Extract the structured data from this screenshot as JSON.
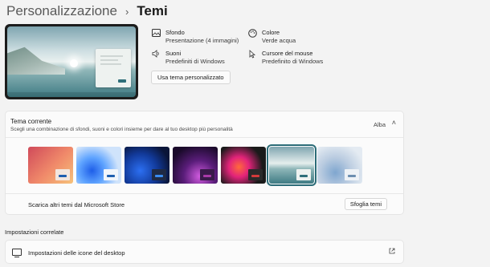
{
  "breadcrumb": {
    "parent": "Personalizzazione",
    "separator": "›",
    "current": "Temi"
  },
  "properties": {
    "background": {
      "icon": "image-icon",
      "name": "Sfondo",
      "value": "Presentazione (4 immagini)"
    },
    "color": {
      "icon": "palette-icon",
      "name": "Colore",
      "value": "Verde acqua"
    },
    "sounds": {
      "icon": "speaker-icon",
      "name": "Suoni",
      "value": "Predefiniti di Windows"
    },
    "cursor": {
      "icon": "cursor-icon",
      "name": "Cursore del mouse",
      "value": "Predefinito di Windows"
    }
  },
  "custom_button": "Usa tema personalizzato",
  "current_theme": {
    "title": "Tema corrente",
    "subtitle": "Scegli una combinazione di sfondi, suoni e colori insieme per dare al tuo desktop più personalità",
    "value": "Alba",
    "chevron": "˄"
  },
  "themes": [
    {
      "name": "theme-1",
      "bg": "linear-gradient(135deg,#d04a5a,#f08a6a 55%,#f6c27a)",
      "win": "#f3e6de",
      "accent": "#1f5fb0",
      "selected": false
    },
    {
      "name": "theme-2",
      "bg": "radial-gradient(circle at 35% 65%,#1e5ee8,#5fa4ff 35%,#cfe3fb 70%)",
      "win": "#f1f5fb",
      "accent": "#1f5fb0",
      "selected": false
    },
    {
      "name": "theme-3",
      "bg": "radial-gradient(circle at 35% 65%,#2c6ff2,#123a9a 45%,#0a1538 80%)",
      "win": "#1f2a44",
      "accent": "#3a8cf0",
      "selected": false
    },
    {
      "name": "theme-4",
      "bg": "radial-gradient(circle at 60% 80%,#d25ce0,#5a1d7a 40%,#1a0a2a 80%)",
      "win": "#3a1a4a",
      "accent": "#a83aa8",
      "selected": false
    },
    {
      "name": "theme-5",
      "bg": "radial-gradient(circle at 40% 55%,#ff6a3a,#e2237a 30%,#1a1a1a 70%)",
      "win": "#2a2a2a",
      "accent": "#d23a3a",
      "selected": false
    },
    {
      "name": "theme-6",
      "bg": "linear-gradient(180deg,#7fa5b0,#e5eeed 45%,#8fb6b8 60%,#3f7b84)",
      "win": "#eef2f0",
      "accent": "#2f6f7a",
      "selected": true
    },
    {
      "name": "theme-7",
      "bg": "radial-gradient(circle at 40% 70%,#7fa6cf,#b9cbe0 40%,#e4ebf2 80%)",
      "win": "#eef2f6",
      "accent": "#6d8fb0",
      "selected": false
    }
  ],
  "store": {
    "text": "Scarica altri temi dal Microsoft Store",
    "button": "Sfoglia temi"
  },
  "related": {
    "title": "Impostazioni correlate",
    "item": "Impostazioni delle icone del desktop",
    "ext_icon": "external-link-icon"
  }
}
